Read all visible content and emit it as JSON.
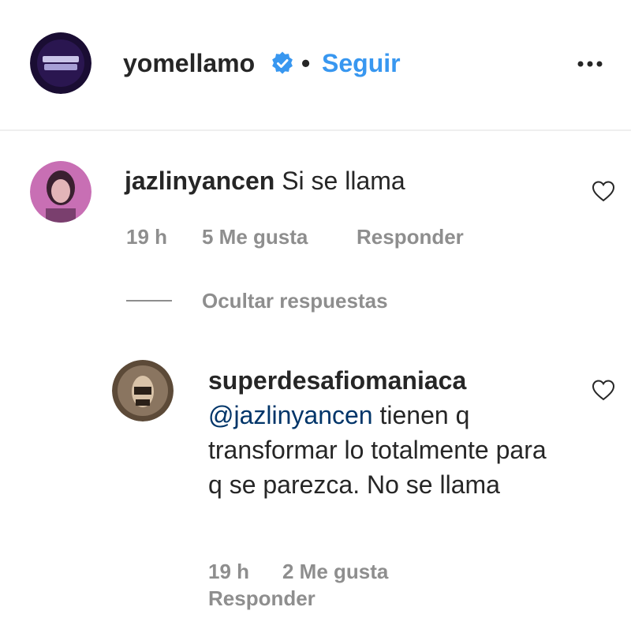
{
  "post": {
    "username": "yomellamo",
    "separator": "•",
    "follow_label": "Seguir",
    "verified_icon": "verified-badge-icon",
    "more_icon": "more-options-icon"
  },
  "comment": {
    "username": "jazlinyancen",
    "text": "Si se llama",
    "time": "19 h",
    "likes": "5 Me gusta",
    "reply_label": "Responder"
  },
  "hide_replies_label": "Ocultar respuestas",
  "reply": {
    "username": "superdesafiomaniaca",
    "mention": "@jazlinyancen",
    "text": " tienen q transformar lo totalmente para q se parezca. No se llama",
    "time": "19 h",
    "likes": "2 Me gusta",
    "reply_label": "Responder"
  },
  "colors": {
    "link": "#3897f0",
    "mention": "#003569",
    "muted": "#8e8e8e",
    "text": "#262626"
  }
}
